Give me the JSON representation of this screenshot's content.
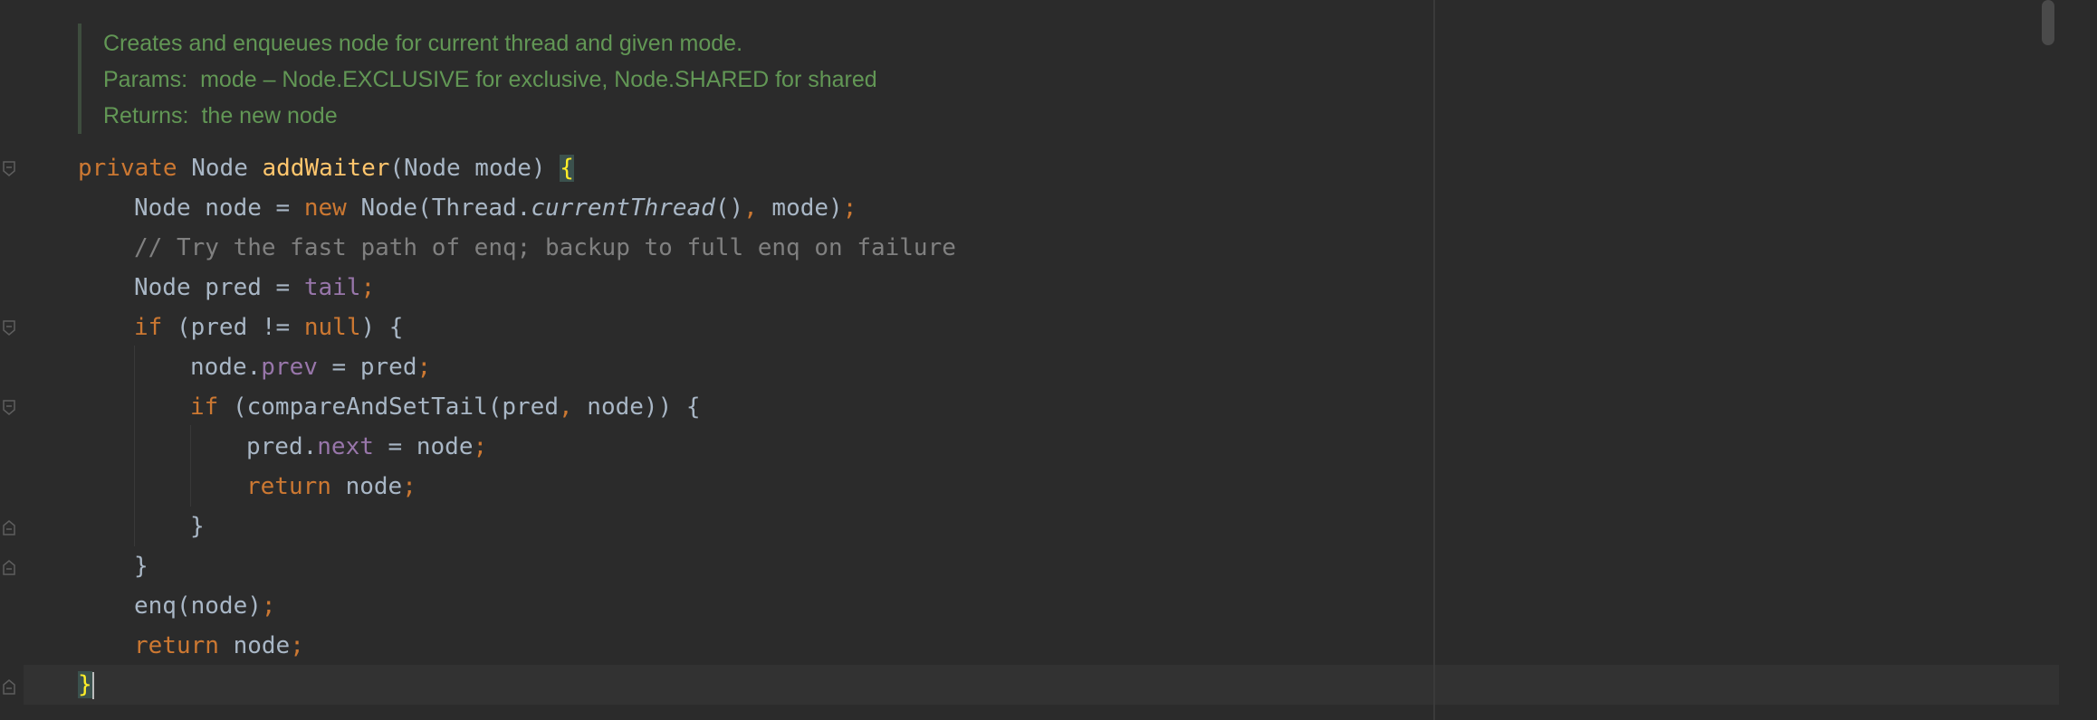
{
  "doc": {
    "summary": "Creates and enqueues node for current thread and given mode.",
    "params_tag": "Params:",
    "params_text": "mode – Node.EXCLUSIVE for exclusive, Node.SHARED for shared",
    "returns_tag": "Returns:",
    "returns_text": "the new node"
  },
  "code": {
    "l1": {
      "kw": "private",
      "type": " Node ",
      "fn": "addWaiter",
      "rest": "(Node mode) ",
      "brace": "{"
    },
    "l2": {
      "a": "Node node = ",
      "kw": "new",
      "b": " Node(Thread.",
      "it": "currentThread",
      "c": "()",
      "comma": ",",
      "d": " mode)",
      "semi": ";"
    },
    "l3": {
      "comment": "// Try the fast path of enq; backup to full enq on failure"
    },
    "l4": {
      "a": "Node pred = ",
      "field": "tail",
      "semi": ";"
    },
    "l5": {
      "kw": "if",
      "a": " (pred != ",
      "null": "null",
      "b": ") {"
    },
    "l6": {
      "a": "node.",
      "field": "prev",
      "b": " = pred",
      "semi": ";"
    },
    "l7": {
      "kw": "if",
      "a": " (compareAndSetTail(pred",
      "comma": ",",
      "b": " node)) {"
    },
    "l8": {
      "a": "pred.",
      "field": "next",
      "b": " = node",
      "semi": ";"
    },
    "l9": {
      "kw": "return",
      "a": " node",
      "semi": ";"
    },
    "l10": {
      "a": "}"
    },
    "l11": {
      "a": "}"
    },
    "l12": {
      "a": "enq(node)",
      "semi": ";"
    },
    "l13": {
      "kw": "return",
      "a": " node",
      "semi": ";"
    },
    "l14": {
      "brace": "}"
    }
  },
  "icons": {
    "fold_open": "fold-open-icon",
    "fold_close": "fold-close-icon"
  },
  "colors": {
    "background": "#2b2b2b",
    "keyword": "#cc7832",
    "function": "#ffc66d",
    "field": "#9876aa",
    "comment": "#808080",
    "doc": "#629755",
    "text": "#a9b7c6",
    "brace_highlight": "#ffef28"
  }
}
